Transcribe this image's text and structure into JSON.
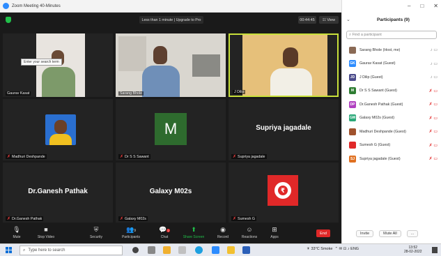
{
  "window": {
    "title": "Zoom Meeting 40-Minutes"
  },
  "topbar": {
    "trial_notice": "Less than 1 minute | Upgrade to Pro",
    "timer": "00:44:45",
    "view_label": "View"
  },
  "tiles": [
    {
      "name": "Gaurav Kasat",
      "tooltip": "Enter your search term",
      "muted": false
    },
    {
      "name": "Sarang Bhole",
      "muted": false
    },
    {
      "name": "J Dilip",
      "muted": false,
      "active": true
    },
    {
      "name": "Madhuri Deshpande",
      "muted": true
    },
    {
      "name": "Dr S S Sawant",
      "muted": true,
      "avatar_letter": "M"
    },
    {
      "name": "Supriya Jagadale",
      "muted": true,
      "display": "Supriya jagadale"
    },
    {
      "name": "Dr.Ganesh Pathak",
      "muted": true,
      "display": "Dr.Ganesh Pathak"
    },
    {
      "name": "Galaxy M02s",
      "muted": true,
      "display": "Galaxy M02s"
    },
    {
      "name": "Sumesh G",
      "muted": true
    }
  ],
  "toolbar": {
    "mute": "Mute",
    "stop_video": "Stop Video",
    "security": "Security",
    "participants": "Participants",
    "participants_count": "9",
    "chat": "Chat",
    "chat_badge": "2",
    "share": "Share Screen",
    "record": "Record",
    "reactions": "Reactions",
    "apps": "Apps",
    "end": "End"
  },
  "panel": {
    "title": "Participants (9)",
    "search_placeholder": "Find a participant",
    "participants": [
      {
        "name": "Sarang Bhole (Host, me)",
        "initials": "",
        "color": "#8a6a55",
        "muted": false
      },
      {
        "name": "Gaurav Kasat (Guest)",
        "initials": "GK",
        "color": "#2d8cff",
        "muted": false
      },
      {
        "name": "J Dilip (Guest)",
        "initials": "JD",
        "color": "#4a4a8a",
        "muted": false
      },
      {
        "name": "Dr S S Sawant (Guest)",
        "initials": "M",
        "color": "#2e7d32",
        "muted": true
      },
      {
        "name": "Dr.Ganesh Pathak (Guest)",
        "initials": "DP",
        "color": "#b040c0",
        "muted": true
      },
      {
        "name": "Galaxy M02s (Guest)",
        "initials": "GM",
        "color": "#2aa878",
        "muted": true
      },
      {
        "name": "Madhuri Deshpande (Guest)",
        "initials": "",
        "color": "#a0522d",
        "muted": true
      },
      {
        "name": "Sumesh G (Guest)",
        "initials": "",
        "color": "#e02828",
        "muted": true
      },
      {
        "name": "Supriya jagadale (Guest)",
        "initials": "SJ",
        "color": "#e07020",
        "muted": true
      }
    ],
    "invite": "Invite",
    "mute_all": "Mute All",
    "more": "..."
  },
  "taskbar": {
    "search_placeholder": "Type here to search",
    "weather": "33°C Smoke",
    "lang": "ENG",
    "time": "13:52",
    "date": "28-02-2022"
  }
}
